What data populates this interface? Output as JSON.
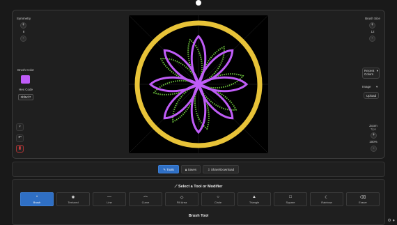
{
  "left": {
    "symmetry_label": "Symmetry",
    "symmetry_value": "8",
    "brush_color_label": "Brush Color",
    "hex_code_label": "Hex Code",
    "hex_value": "#bf5cf7",
    "brush_color": "#bf5cf7"
  },
  "right": {
    "brush_size_label": "Brush Size",
    "brush_size_value": "12",
    "recent_colors_label": "Recent Colors",
    "image_label": "Image",
    "upload_label": "Upload",
    "zoom_label": "Zoom",
    "zoom_sub": "Tips",
    "zoom_value": "100%"
  },
  "tabs": [
    {
      "label": "Tools",
      "icon": "pencil-icon"
    },
    {
      "label": "Saves",
      "icon": "lock-icon"
    },
    {
      "label": "Share/Download",
      "icon": "download-icon"
    }
  ],
  "panel": {
    "title": "Select a Tool or Modifier",
    "current_tool": "Brush Tool"
  },
  "tools": [
    {
      "label": "Brush",
      "glyph": "•"
    },
    {
      "label": "Textured",
      "glyph": "✺"
    },
    {
      "label": "Line",
      "glyph": "—"
    },
    {
      "label": "Curve",
      "glyph": "⌒"
    },
    {
      "label": "Fill Area",
      "glyph": "◇"
    },
    {
      "label": "Circle",
      "glyph": "○"
    },
    {
      "label": "Triangle",
      "glyph": "▲"
    },
    {
      "label": "Square",
      "glyph": "□"
    },
    {
      "label": "Rainbow",
      "glyph": "☾"
    },
    {
      "label": "Eraser",
      "glyph": "⌫"
    }
  ],
  "colors": {
    "accent": "#2f6fc4",
    "ring": "#e8c338",
    "petal": "#bf5cf7",
    "leaf": "#6abf3b"
  }
}
